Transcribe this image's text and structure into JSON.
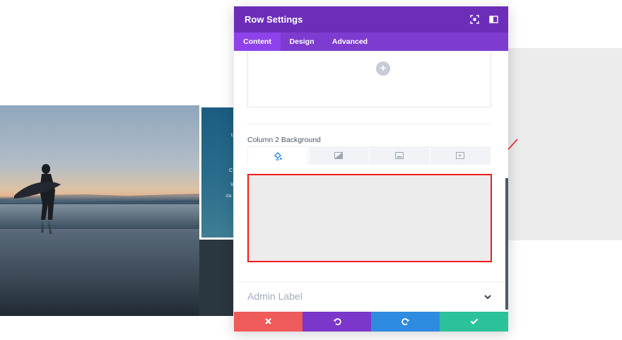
{
  "modal": {
    "title": "Row Settings",
    "header_icons": [
      "fullscreen-icon",
      "sidebar-toggle-icon"
    ],
    "tabs": [
      {
        "label": "Content",
        "active": true
      },
      {
        "label": "Design",
        "active": false
      },
      {
        "label": "Advanced",
        "active": false
      }
    ],
    "upload": {
      "icon": "plus-icon",
      "glyph": "+"
    },
    "column_background": {
      "label": "Column 2 Background",
      "types": [
        {
          "icon": "paint-bucket-icon",
          "active": true
        },
        {
          "icon": "gradient-icon",
          "active": false
        },
        {
          "icon": "image-icon",
          "active": false
        },
        {
          "icon": "video-icon",
          "active": false
        }
      ],
      "color_preview": "#ececec",
      "highlight_color": "#ef1b1b"
    },
    "admin_label": {
      "label": "Admin Label",
      "icon": "chevron-down-icon"
    },
    "footer": [
      {
        "action": "discard",
        "icon": "close-icon",
        "color": "#ef5a5a"
      },
      {
        "action": "undo",
        "icon": "undo-icon",
        "color": "#7a37c9"
      },
      {
        "action": "redo",
        "icon": "redo-icon",
        "color": "#2f8be0"
      },
      {
        "action": "save",
        "icon": "check-icon",
        "color": "#2bc29a"
      }
    ]
  },
  "colors": {
    "header_purple": "#6c2eb9",
    "tabs_purple": "#7e3bd0",
    "annotation_red": "#ef1b1b"
  },
  "background_page": {
    "panel_text": [
      "L",
      "C",
      "V",
      "cu"
    ]
  }
}
